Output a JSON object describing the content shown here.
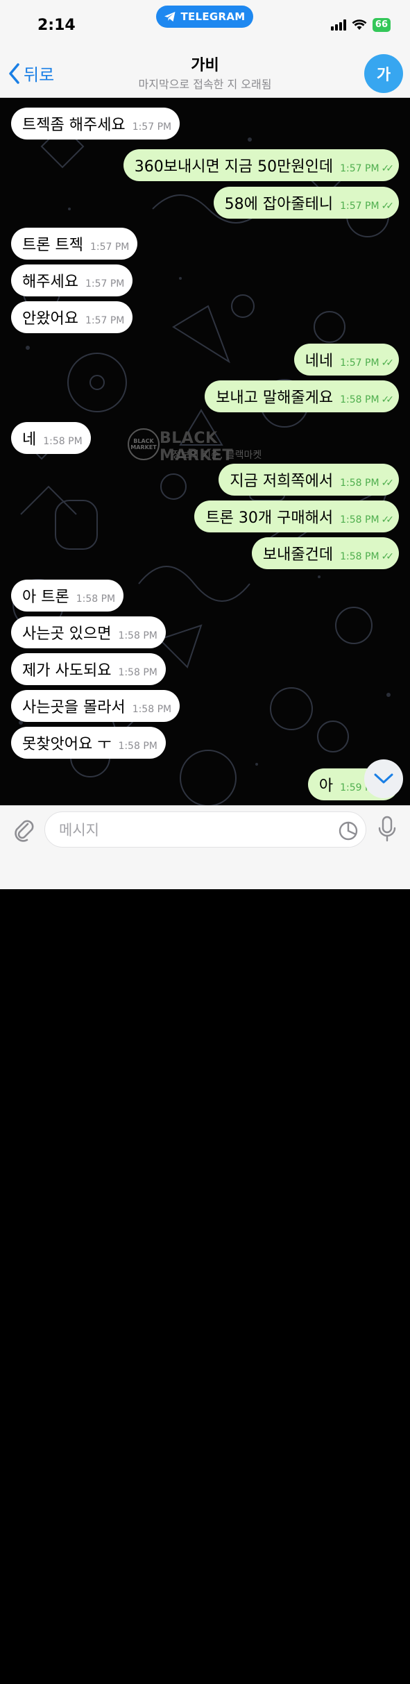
{
  "status_bar": {
    "time": "2:14",
    "app_pill": "TELEGRAM",
    "battery": "66"
  },
  "header": {
    "back_label": "뒤로",
    "title": "가비",
    "subtitle": "마지막으로 접속한 지 오래됨",
    "avatar_letter": "가"
  },
  "messages": [
    {
      "dir": "in",
      "text": "트젝좀 해주세요",
      "time": "1:57 PM"
    },
    {
      "dir": "out",
      "text": "360보내시면 지금 50만원인데",
      "time": "1:57 PM"
    },
    {
      "dir": "out",
      "text": "58에 잡아줄테니",
      "time": "1:57 PM"
    },
    {
      "dir": "in",
      "text": "트론 트젝",
      "time": "1:57 PM"
    },
    {
      "dir": "in",
      "text": "해주세요",
      "time": "1:57 PM"
    },
    {
      "dir": "in",
      "text": "안왔어요",
      "time": "1:57 PM"
    },
    {
      "dir": "out",
      "text": "네네",
      "time": "1:57 PM"
    },
    {
      "dir": "out",
      "text": "보내고 말해줄게요",
      "time": "1:58 PM"
    },
    {
      "dir": "in",
      "text": "네",
      "time": "1:58 PM"
    },
    {
      "dir": "out",
      "text": "지금 저희쪽에서",
      "time": "1:58 PM"
    },
    {
      "dir": "out",
      "text": "트론 30개 구매해서",
      "time": "1:58 PM"
    },
    {
      "dir": "out",
      "text": "보내줄건데",
      "time": "1:58 PM"
    },
    {
      "dir": "in",
      "text": "아 트론",
      "time": "1:58 PM"
    },
    {
      "dir": "in",
      "text": "사는곳 있으면",
      "time": "1:58 PM"
    },
    {
      "dir": "in",
      "text": "제가 사도되요",
      "time": "1:58 PM"
    },
    {
      "dir": "in",
      "text": "사는곳을 몰라서",
      "time": "1:58 PM"
    },
    {
      "dir": "in",
      "text": "못찾앗어요 ㅜ",
      "time": "1:58 PM"
    },
    {
      "dir": "out",
      "text": "아",
      "time": "1:59 PM"
    }
  ],
  "watermark": {
    "badge": "BLACK MARKET",
    "title": "BLACK MARKET",
    "subtitle": "정보의 기준, 블랙마켓"
  },
  "composer": {
    "placeholder": "메시지"
  },
  "colors": {
    "accent": "#1a7fe5",
    "outgoing_bubble": "#dcf8c6",
    "incoming_bubble": "#ffffff",
    "read_check": "#4fae4e"
  },
  "icons": [
    "telegram-icon",
    "signal-icon",
    "wifi-icon",
    "battery-icon",
    "back-chevron-icon",
    "paperclip-icon",
    "sticker-icon",
    "microphone-icon",
    "chevron-down-icon"
  ]
}
